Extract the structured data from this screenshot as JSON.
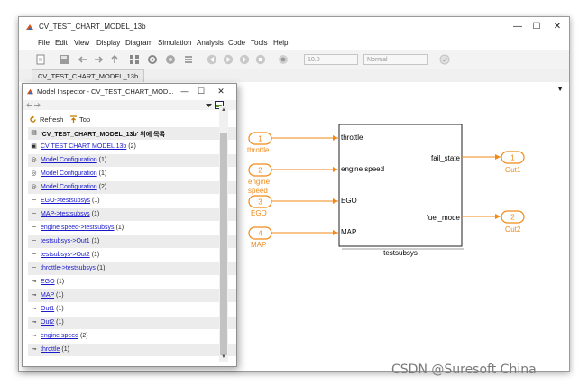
{
  "main_window": {
    "title": "CV_TEST_CHART_MODEL_13b",
    "menu": [
      "File",
      "Edit",
      "View",
      "Display",
      "Diagram",
      "Simulation",
      "Analysis",
      "Code",
      "Tools",
      "Help"
    ],
    "sim_time": "10.0",
    "sim_mode": "Normal",
    "tab": "CV_TEST_CHART_MODEL_13b",
    "window_buttons": {
      "minimize": "—",
      "maximize": "☐",
      "close": "✕"
    }
  },
  "diagram": {
    "subsystem_name": "testsubsys",
    "subsystem_inputs": [
      "throttle",
      "engine speed",
      "EGO",
      "MAP"
    ],
    "subsystem_outputs": [
      "fail_state",
      "fuel_mode"
    ],
    "inports": [
      {
        "num": "1",
        "label": "throttle"
      },
      {
        "num": "2",
        "label_line1": "engine",
        "label_line2": "speed"
      },
      {
        "num": "3",
        "label": "EGO"
      },
      {
        "num": "4",
        "label": "MAP"
      }
    ],
    "outports": [
      {
        "num": "1",
        "label": "Out1"
      },
      {
        "num": "2",
        "label": "Out2"
      }
    ],
    "colors": {
      "port": "#f08a18",
      "block_border": "#222222"
    }
  },
  "inspector": {
    "title": "Model Inspector - CV_TEST_CHART_MOD...",
    "refresh_label": "Refresh",
    "top_label": "Top",
    "items": [
      {
        "icon": "folder",
        "text": "'CV_TEST_CHART_MODEL_13b' 위에 목록",
        "count": "",
        "link": false,
        "bold": true
      },
      {
        "icon": "model",
        "text": "CV TEST CHART MODEL 13b",
        "count": "(2)",
        "link": true,
        "bold": false
      },
      {
        "icon": "config",
        "text": "Model Configuration",
        "count": "(1)",
        "link": true,
        "bold": false
      },
      {
        "icon": "config",
        "text": "Model Configuration",
        "count": "(1)",
        "link": true,
        "bold": false
      },
      {
        "icon": "config",
        "text": "Model Configuration",
        "count": "(2)",
        "link": true,
        "bold": false
      },
      {
        "icon": "signal",
        "text": "EGO->testsubsys",
        "count": "(1)",
        "link": true,
        "bold": false
      },
      {
        "icon": "signal",
        "text": "MAP->testsubsys",
        "count": "(1)",
        "link": true,
        "bold": false
      },
      {
        "icon": "signal",
        "text": "engine speed->testsubsys",
        "count": "(1)",
        "link": true,
        "bold": false
      },
      {
        "icon": "signal",
        "text": "testsubsys->Out1",
        "count": "(1)",
        "link": true,
        "bold": false
      },
      {
        "icon": "signal",
        "text": "testsubsys->Out2",
        "count": "(1)",
        "link": true,
        "bold": false
      },
      {
        "icon": "signal",
        "text": "throttle->testsubsys",
        "count": "(1)",
        "link": true,
        "bold": false
      },
      {
        "icon": "port",
        "text": "EGO",
        "count": "(1)",
        "link": true,
        "bold": false
      },
      {
        "icon": "port",
        "text": "MAP",
        "count": "(1)",
        "link": true,
        "bold": false
      },
      {
        "icon": "port",
        "text": "Out1",
        "count": "(1)",
        "link": true,
        "bold": false
      },
      {
        "icon": "port",
        "text": "Out2",
        "count": "(1)",
        "link": true,
        "bold": false
      },
      {
        "icon": "port",
        "text": "engine speed",
        "count": "(2)",
        "link": true,
        "bold": false
      },
      {
        "icon": "port",
        "text": "throttle",
        "count": "(1)",
        "link": true,
        "bold": false
      }
    ]
  },
  "watermark": "CSDN @Suresoft China"
}
